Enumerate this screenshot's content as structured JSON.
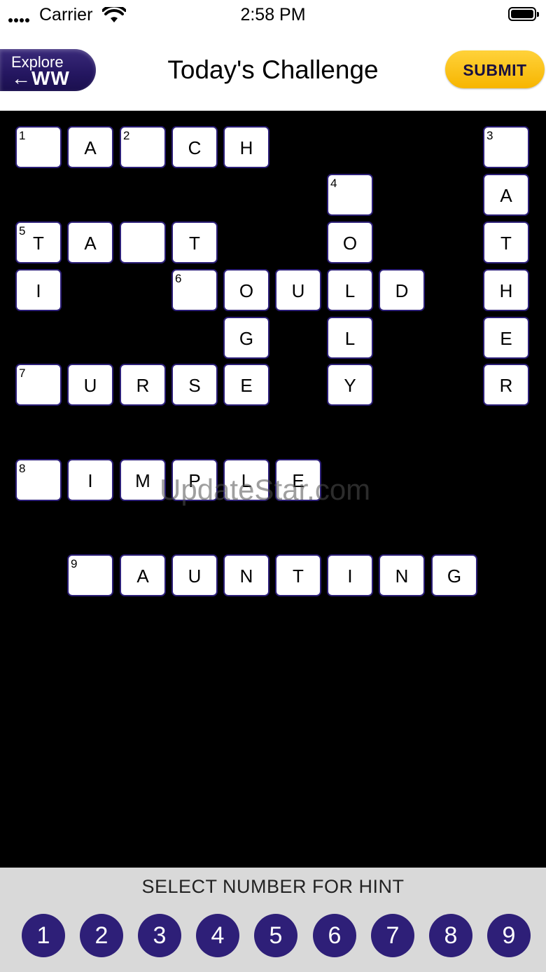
{
  "status": {
    "carrier": "Carrier",
    "time": "2:58 PM"
  },
  "header": {
    "explore_line1": "Explore",
    "explore_line2": "←WW",
    "title": "Today's Challenge",
    "submit": "SUBMIT"
  },
  "puzzle": {
    "watermark": "UpdateStar.com",
    "cells": [
      {
        "num": "1",
        "letter": ""
      },
      {
        "num": "",
        "letter": "A"
      },
      {
        "num": "2",
        "letter": ""
      },
      {
        "num": "",
        "letter": "C"
      },
      {
        "num": "",
        "letter": "H"
      },
      {
        "num": "3",
        "letter": ""
      },
      {
        "num": "4",
        "letter": ""
      },
      {
        "num": "",
        "letter": "A"
      },
      {
        "num": "5",
        "letter": "T"
      },
      {
        "num": "",
        "letter": "A"
      },
      {
        "num": "",
        "letter": ""
      },
      {
        "num": "",
        "letter": "T"
      },
      {
        "num": "",
        "letter": "O"
      },
      {
        "num": "",
        "letter": "T"
      },
      {
        "num": "",
        "letter": "I"
      },
      {
        "num": "6",
        "letter": ""
      },
      {
        "num": "",
        "letter": "O"
      },
      {
        "num": "",
        "letter": "U"
      },
      {
        "num": "",
        "letter": "L"
      },
      {
        "num": "",
        "letter": "D"
      },
      {
        "num": "",
        "letter": "H"
      },
      {
        "num": "",
        "letter": "G"
      },
      {
        "num": "",
        "letter": "L"
      },
      {
        "num": "",
        "letter": "E"
      },
      {
        "num": "7",
        "letter": ""
      },
      {
        "num": "",
        "letter": "U"
      },
      {
        "num": "",
        "letter": "R"
      },
      {
        "num": "",
        "letter": "S"
      },
      {
        "num": "",
        "letter": "E"
      },
      {
        "num": "",
        "letter": "Y"
      },
      {
        "num": "",
        "letter": "R"
      },
      {
        "num": "8",
        "letter": ""
      },
      {
        "num": "",
        "letter": "I"
      },
      {
        "num": "",
        "letter": "M"
      },
      {
        "num": "",
        "letter": "P"
      },
      {
        "num": "",
        "letter": "L"
      },
      {
        "num": "",
        "letter": "E"
      },
      {
        "num": "9",
        "letter": ""
      },
      {
        "num": "",
        "letter": "A"
      },
      {
        "num": "",
        "letter": "U"
      },
      {
        "num": "",
        "letter": "N"
      },
      {
        "num": "",
        "letter": "T"
      },
      {
        "num": "",
        "letter": "I"
      },
      {
        "num": "",
        "letter": "N"
      },
      {
        "num": "",
        "letter": "G"
      }
    ]
  },
  "hints": {
    "label": "SELECT NUMBER FOR HINT",
    "numbers": [
      "1",
      "2",
      "3",
      "4",
      "5",
      "6",
      "7",
      "8",
      "9"
    ]
  }
}
